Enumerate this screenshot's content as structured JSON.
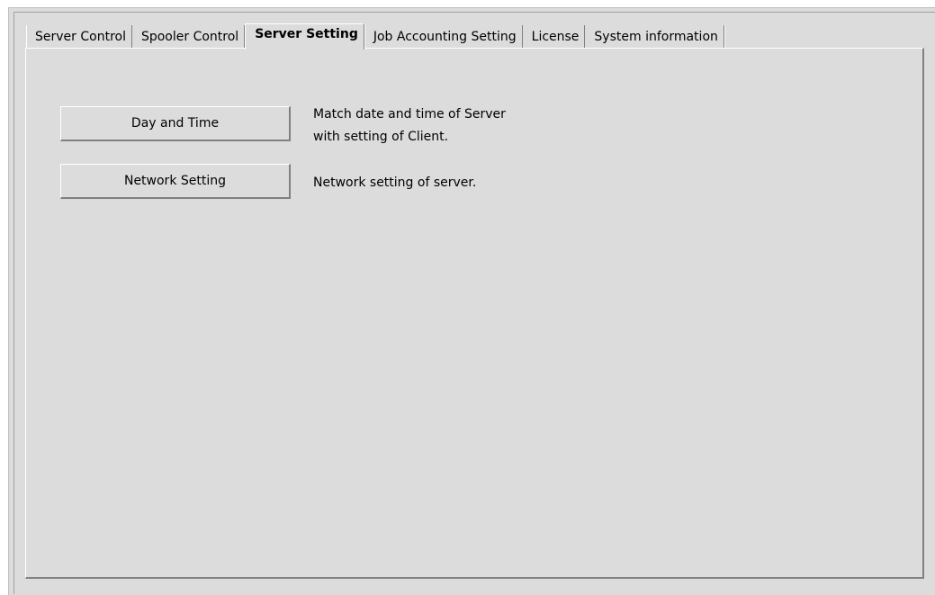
{
  "tabs": [
    {
      "label": "Server Control",
      "active": false
    },
    {
      "label": "Spooler Control",
      "active": false
    },
    {
      "label": "Server Setting",
      "active": true
    },
    {
      "label": "Job Accounting Setting",
      "active": false
    },
    {
      "label": "License",
      "active": false
    },
    {
      "label": "System information",
      "active": false
    }
  ],
  "server_setting": {
    "day_and_time": {
      "button_label": "Day and Time",
      "description_line1": "Match date and time of Server",
      "description_line2": "with setting of Client."
    },
    "network_setting": {
      "button_label": "Network Setting",
      "description": "Network setting of server."
    }
  },
  "colors": {
    "background": "#dcdcdc",
    "highlight": "#ffffff",
    "shadow": "#808080"
  }
}
